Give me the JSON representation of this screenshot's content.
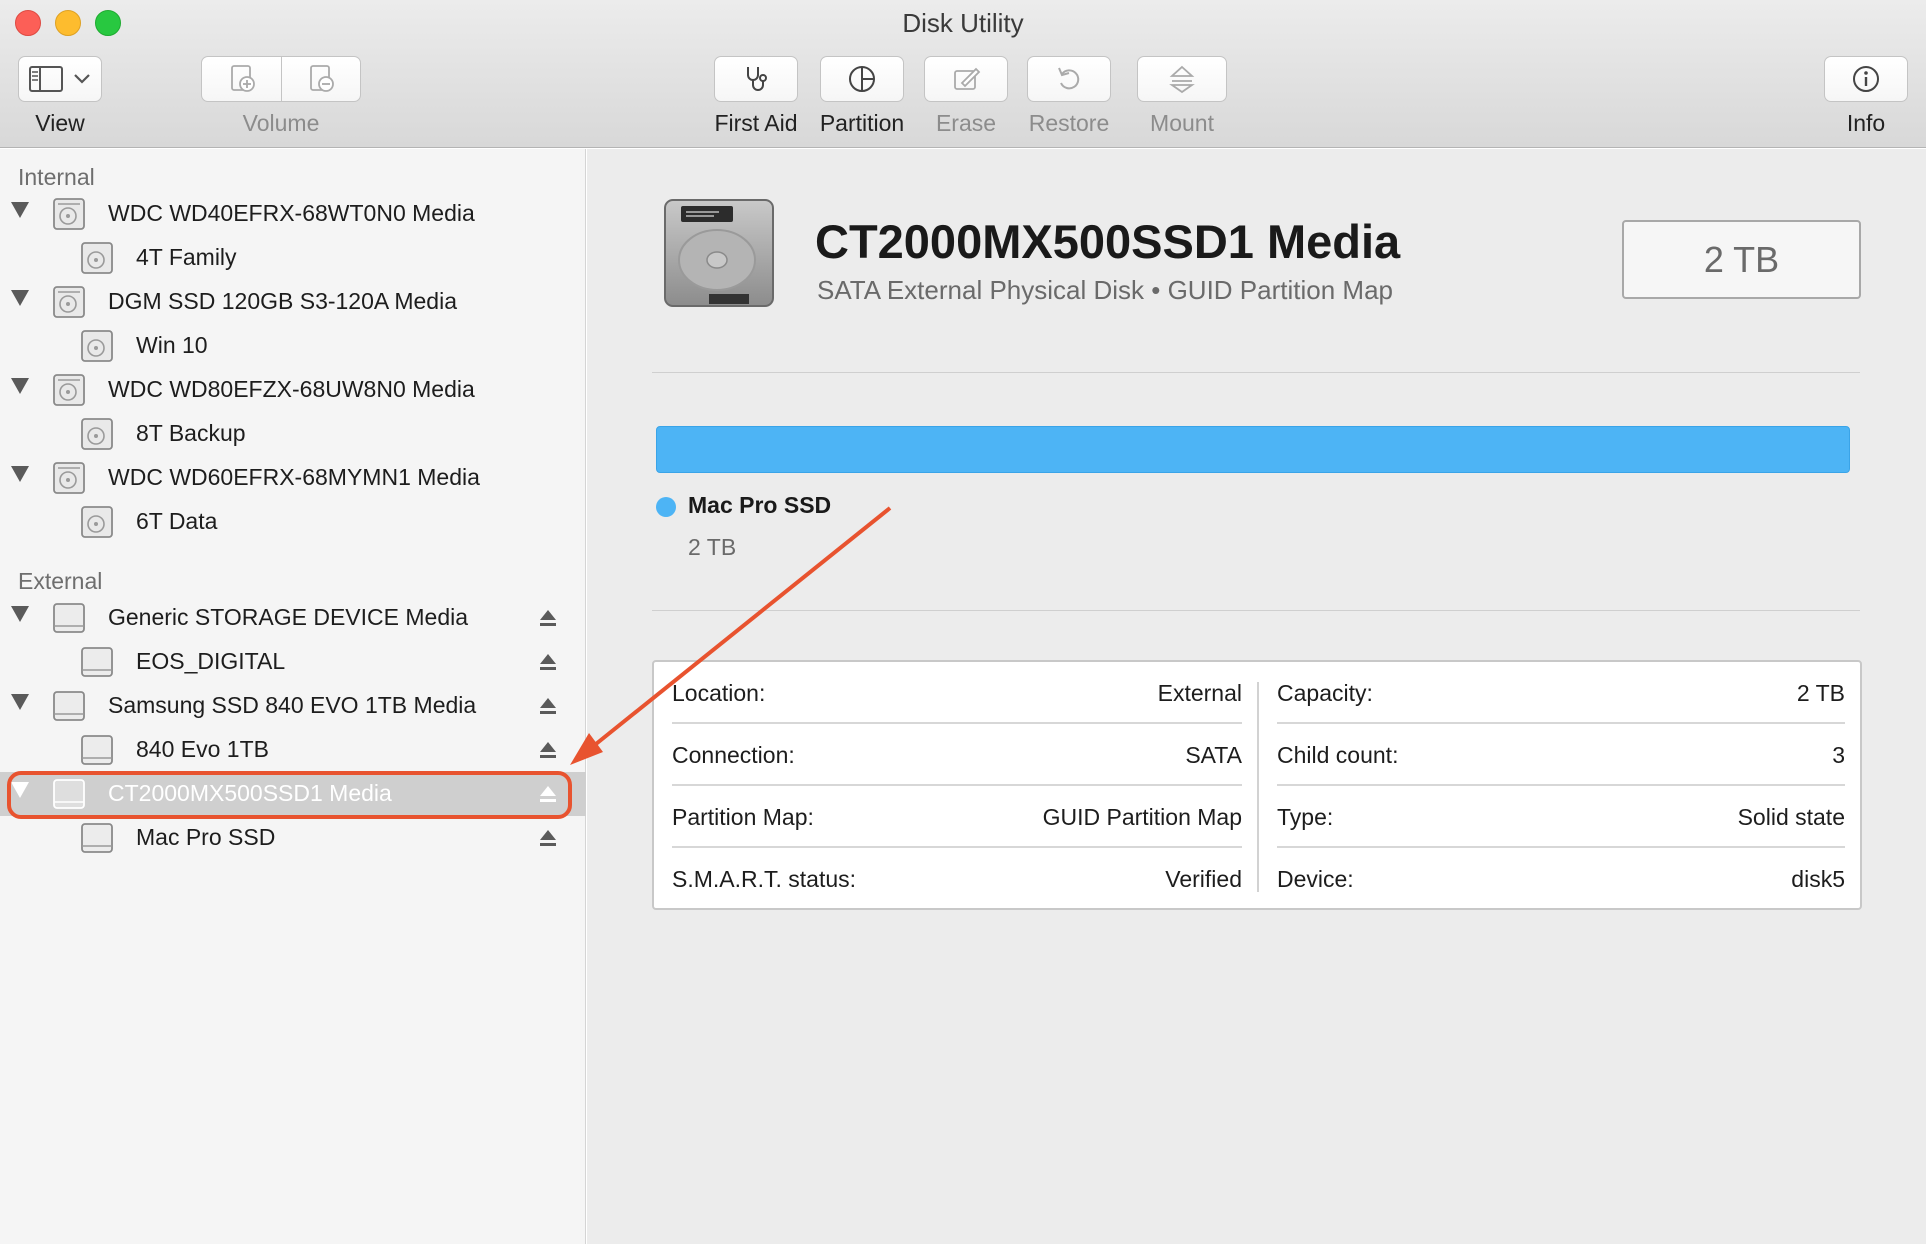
{
  "window": {
    "title": "Disk Utility"
  },
  "toolbar": {
    "view_label": "View",
    "volume_label": "Volume",
    "first_aid_label": "First Aid",
    "partition_label": "Partition",
    "erase_label": "Erase",
    "restore_label": "Restore",
    "mount_label": "Mount",
    "info_label": "Info"
  },
  "sidebar": {
    "internal_header": "Internal",
    "external_header": "External",
    "internal": [
      {
        "disk": "WDC WD40EFRX-68WT0N0 Media",
        "volume": "4T Family"
      },
      {
        "disk": "DGM SSD 120GB S3-120A Media",
        "volume": "Win 10"
      },
      {
        "disk": "WDC WD80EFZX-68UW8N0 Media",
        "volume": "8T Backup"
      },
      {
        "disk": "WDC WD60EFRX-68MYMN1 Media",
        "volume": "6T Data"
      }
    ],
    "external": [
      {
        "disk": "Generic STORAGE DEVICE Media",
        "volume": "EOS_DIGITAL"
      },
      {
        "disk": "Samsung SSD 840 EVO 1TB Media",
        "volume": "840 Evo 1TB"
      },
      {
        "disk": "CT2000MX500SSD1 Media",
        "volume": "Mac Pro SSD"
      }
    ]
  },
  "main": {
    "disk_name": "CT2000MX500SSD1 Media",
    "disk_subtitle": "SATA External Physical Disk • GUID Partition Map",
    "capacity_badge": "2 TB",
    "partition": {
      "name": "Mac Pro SSD",
      "size": "2 TB",
      "color": "#4db4f5"
    },
    "info": {
      "location_key": "Location:",
      "location_val": "External",
      "connection_key": "Connection:",
      "connection_val": "SATA",
      "partition_map_key": "Partition Map:",
      "partition_map_val": "GUID Partition Map",
      "smart_key": "S.M.A.R.T. status:",
      "smart_val": "Verified",
      "capacity_key": "Capacity:",
      "capacity_val": "2 TB",
      "child_count_key": "Child count:",
      "child_count_val": "3",
      "type_key": "Type:",
      "type_val": "Solid state",
      "device_key": "Device:",
      "device_val": "disk5"
    }
  },
  "colors": {
    "accent": "#4db4f5",
    "annotation": "#e8532f",
    "selection": "#cfcfcf"
  }
}
